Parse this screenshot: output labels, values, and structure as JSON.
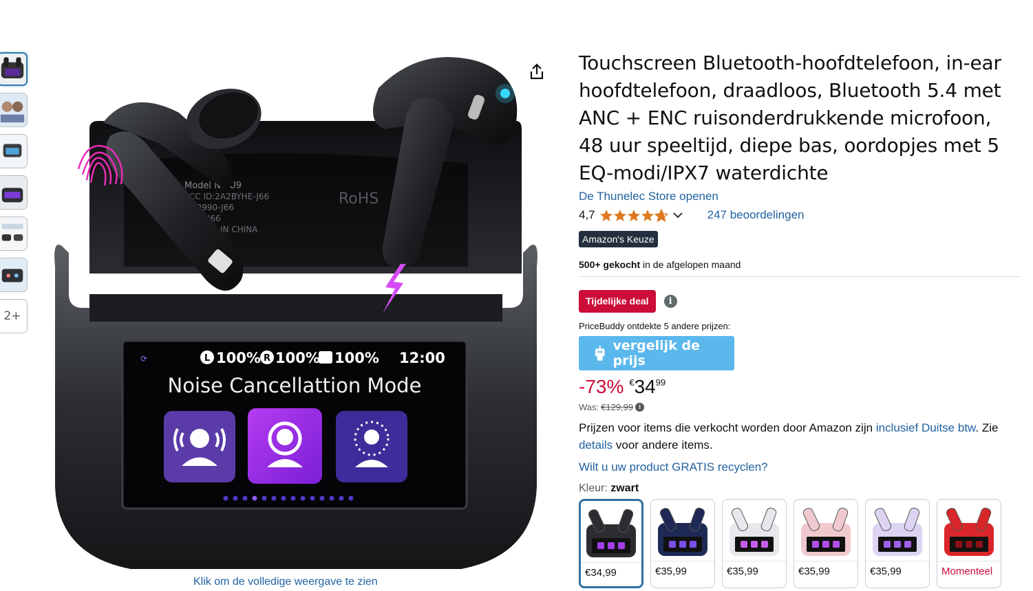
{
  "product": {
    "title": "Touchscreen Bluetooth-hoofdtelefoon, in-ear hoofdtelefoon, draadloos, Bluetooth 5.4 met ANC + ENC ruisonderdrukkende microfoon, 48 uur speeltijd, diepe bas, oordopjes met 5 EQ-modi/IPX7 waterdichte",
    "store_link": "De Thunelec Store openen",
    "rating": "4,7",
    "rating_value": 4.7,
    "reviews": "247 beoordelingen",
    "badge": "Amazon's Keuze",
    "bought_bold": "500+ gekocht",
    "bought_rest": " in de afgelopen maand"
  },
  "deal": {
    "label": "Tijdelijke deal",
    "info_icon": "i"
  },
  "pricebuddy": {
    "label": "PriceBuddy ontdekte 5 andere prijzen:",
    "button": "vergelijk de prijs",
    "icon": "robot-icon"
  },
  "price": {
    "discount": "-73%",
    "currency": "€",
    "whole": "34",
    "fraction": "99",
    "was_label": "Was:",
    "was_value": "€129,99"
  },
  "vat": {
    "text1": "Prijzen voor items die verkocht worden door Amazon zijn ",
    "link1": "inclusief Duitse btw",
    "text2": ". Zie ",
    "link2": "details",
    "text3": " voor andere items."
  },
  "recycle": "Wilt u uw product GRATIS recyclen?",
  "color": {
    "label": "Kleur: ",
    "value": "zwart",
    "swatches": [
      {
        "price": "€34,99",
        "case": "#2b2d31",
        "accent": "#a23ee8"
      },
      {
        "price": "€35,99",
        "case": "#1e2a55",
        "accent": "#7a4ee8"
      },
      {
        "price": "€35,99",
        "case": "#e6e8eb",
        "accent": "#c45de8"
      },
      {
        "price": "€35,99",
        "case": "#f0c9cf",
        "accent": "#b24ee8"
      },
      {
        "price": "€35,99",
        "case": "#dcd4f2",
        "accent": "#9d62e8"
      },
      {
        "price": "Momenteel",
        "case": "#d8262a",
        "accent": "#8a1015"
      }
    ]
  },
  "gallery": {
    "more_label": "2+",
    "caption": "Klik om de volledige weergave te zien",
    "screen": {
      "left": "L",
      "left_pct": "100%",
      "right": "R",
      "right_pct": "100%",
      "case_pct": "100%",
      "time": "12:00",
      "mode": "Noise Cancellattion Mode"
    },
    "case_print": {
      "model": "Model No:U9",
      "fcc": "FCC ID:2A2BYHE-J66",
      "num": "89990-J66",
      "j66": "J66",
      "origin": "IN CHINA",
      "rohs": "RoHS"
    }
  },
  "colors": {
    "link": "#2162a1",
    "deal_red": "#cc0c39",
    "badge_bg": "#232f3e",
    "star": "#de7921",
    "pricebuddy": "#5ab8ec"
  }
}
